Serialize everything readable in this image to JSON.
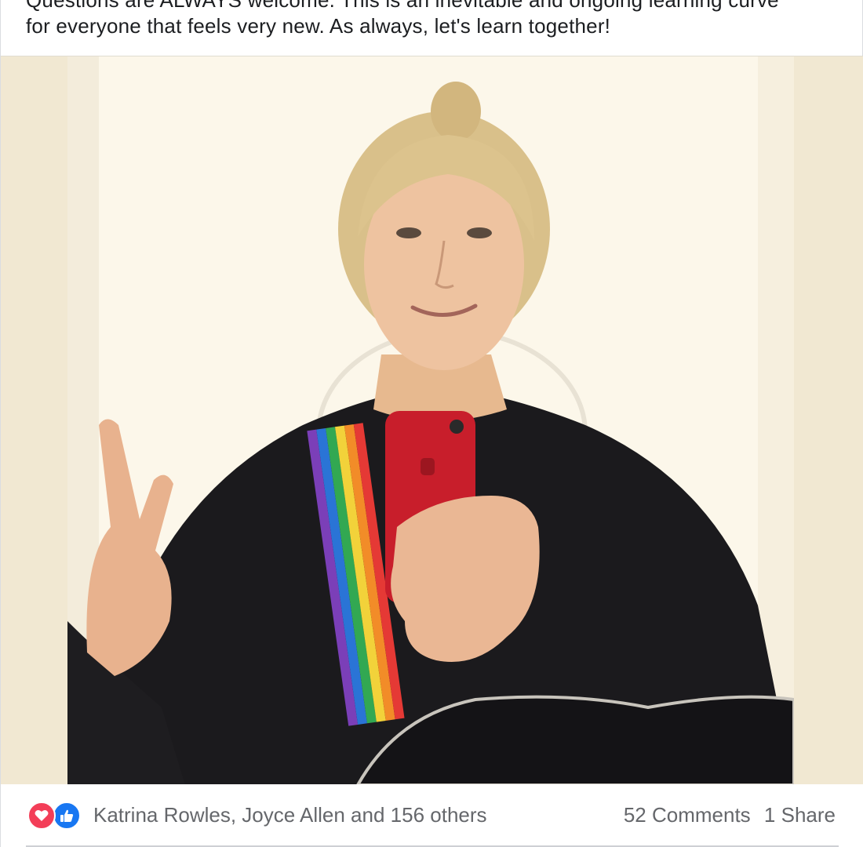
{
  "post": {
    "text_lines": [
      "Questions are ALWAYS welcome. This is an inevitable and ongoing learning curve",
      "for everyone that feels very new. As always, let's learn together!"
    ]
  },
  "photo": {
    "icon": "photo-mirror-selfie"
  },
  "reactions": {
    "icons": [
      "love-icon",
      "like-icon"
    ],
    "reactors_text": "Katrina Rowles, Joyce Allen and 156 others",
    "comments": "52 Comments",
    "shares": "1 Share"
  },
  "colors": {
    "love": "#f33e58",
    "like": "#1877f2",
    "meta_text": "#65676b",
    "photo_background": "#f1e8d2"
  }
}
